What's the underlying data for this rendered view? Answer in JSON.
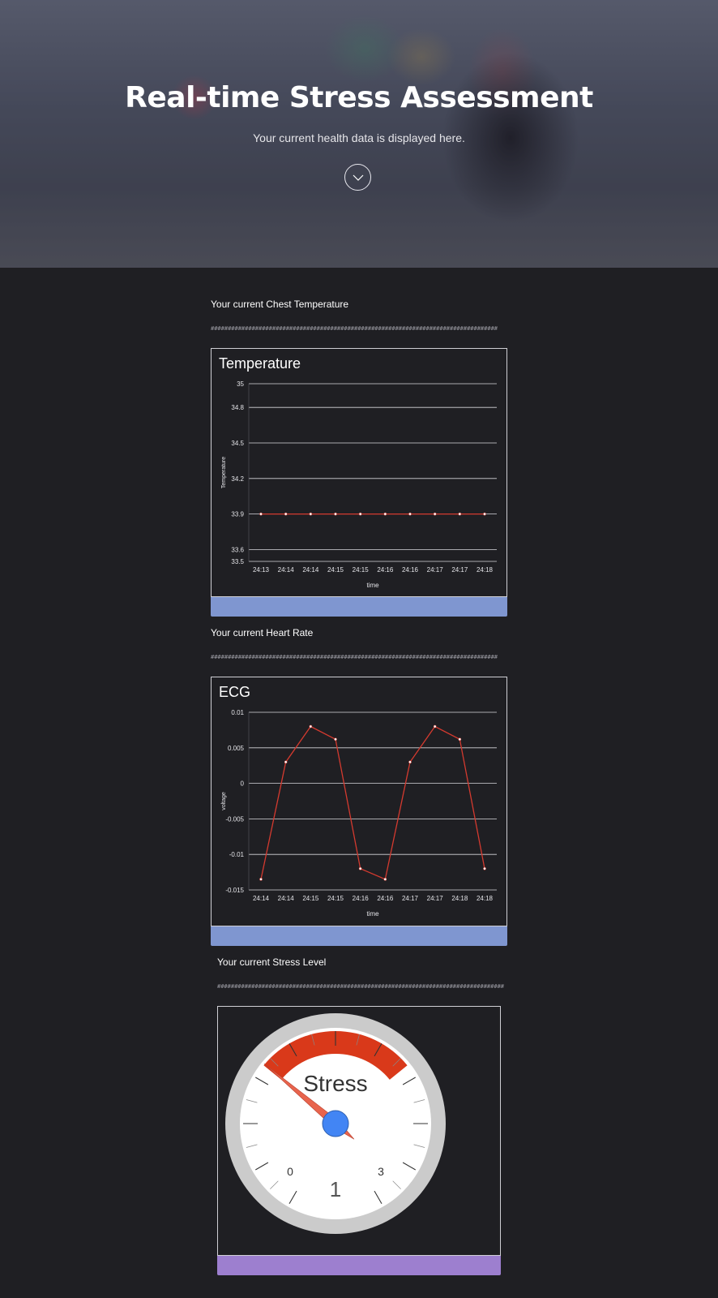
{
  "hero": {
    "title": "Real-time Stress Assessment",
    "subtitle": "Your current health data is displayed here.",
    "scroll_icon": "chevron-down-icon"
  },
  "sections": {
    "temperature": {
      "heading": "Your current Chest Temperature",
      "divider": "####################################################################################"
    },
    "heart": {
      "heading": "Your current Heart Rate",
      "divider": "####################################################################################"
    },
    "stress": {
      "heading": "Your current Stress Level",
      "divider": "####################################################################################"
    }
  },
  "colors": {
    "background": "#1f1f23",
    "line": "#d43a2f",
    "temp_bar": "#7f96d0",
    "ecg_bar": "#7f96d0",
    "stress_bar": "#9d7fcf",
    "gauge_red": "#d9391a",
    "needle": "#e8644d",
    "hub": "#4285f4"
  },
  "chart_data": [
    {
      "type": "line",
      "title": "Temperature",
      "xlabel": "time",
      "ylabel": "Temperature",
      "x": [
        "24:13",
        "24:14",
        "24:14",
        "24:15",
        "24:15",
        "24:16",
        "24:16",
        "24:17",
        "24:17",
        "24:18"
      ],
      "series": [
        {
          "values": [
            33.9,
            33.9,
            33.9,
            33.9,
            33.9,
            33.9,
            33.9,
            33.9,
            33.9,
            33.9
          ]
        }
      ],
      "y_ticks": [
        "35",
        "34.8",
        "34.5",
        "34.2",
        "33.9",
        "33.6",
        "33.5"
      ],
      "ylim": [
        33.5,
        35
      ],
      "grid": true
    },
    {
      "type": "line",
      "title": "ECG",
      "xlabel": "time",
      "ylabel": "voltage",
      "x": [
        "24:14",
        "24:14",
        "24:15",
        "24:15",
        "24:16",
        "24:16",
        "24:17",
        "24:17",
        "24:18",
        "24:18"
      ],
      "series": [
        {
          "values": [
            -0.0135,
            0.003,
            0.008,
            0.0062,
            -0.012,
            -0.0135,
            0.003,
            0.008,
            0.0062,
            -0.012
          ]
        }
      ],
      "y_ticks": [
        "0.01",
        "0.005",
        "0",
        "-0.005",
        "-0.01",
        "-0.015"
      ],
      "ylim": [
        -0.015,
        0.01
      ],
      "grid": true
    }
  ],
  "gauge": {
    "label": "Stress",
    "value": "1",
    "value_num": 1,
    "min_label": "0",
    "max_label": "3",
    "min": 0,
    "max": 3
  }
}
